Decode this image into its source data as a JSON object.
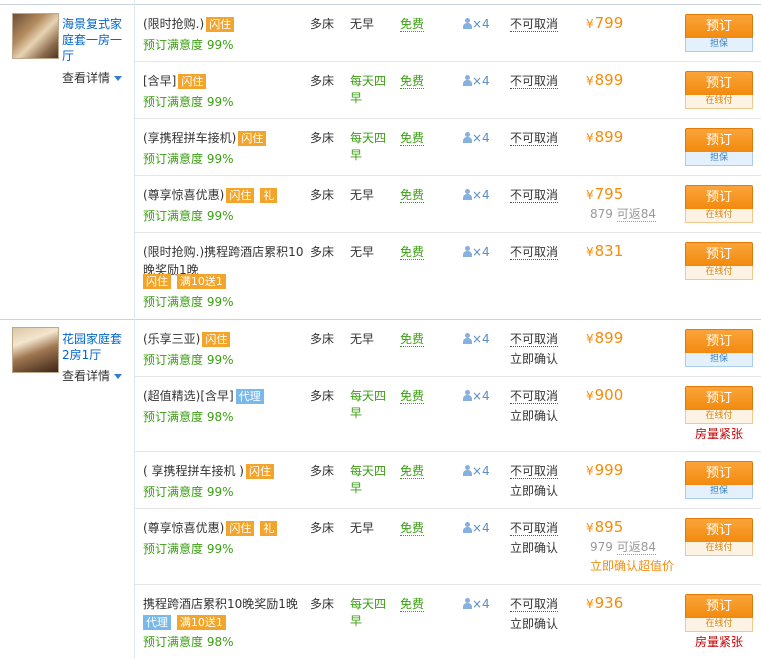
{
  "rooms": [
    {
      "name": "海景复式家庭套一房一厅",
      "detail_label": "查看详情",
      "plans": [
        {
          "title": "(限时抢购.)",
          "tags": [
            {
              "text": "闪住",
              "color": "orange"
            }
          ],
          "satisfaction": "预订满意度 99%",
          "bed": "多床",
          "breakfast": "无早",
          "wifi": "免费",
          "guests": "×4",
          "cancel": "不可取消",
          "instant": "",
          "price": "799",
          "cashback": "",
          "cashback_value": "",
          "book_label": "预订",
          "book_sub": "担保",
          "book_sub_type": "guar",
          "tight": ""
        },
        {
          "title": "[含早]",
          "tags": [
            {
              "text": "闪住",
              "color": "orange"
            }
          ],
          "satisfaction": "预订满意度 99%",
          "bed": "多床",
          "breakfast": "每天四早",
          "wifi": "免费",
          "guests": "×4",
          "cancel": "不可取消",
          "instant": "",
          "price": "899",
          "cashback": "",
          "cashback_value": "",
          "book_label": "预订",
          "book_sub": "在线付",
          "book_sub_type": "payat",
          "tight": ""
        },
        {
          "title": "(享携程拼车接机)",
          "tags": [
            {
              "text": "闪住",
              "color": "orange"
            }
          ],
          "satisfaction": "预订满意度 99%",
          "bed": "多床",
          "breakfast": "每天四早",
          "wifi": "免费",
          "guests": "×4",
          "cancel": "不可取消",
          "instant": "",
          "price": "899",
          "cashback": "",
          "cashback_value": "",
          "book_label": "预订",
          "book_sub": "担保",
          "book_sub_type": "guar",
          "tight": ""
        },
        {
          "title": "(尊享惊喜优惠)",
          "tags": [
            {
              "text": "闪住",
              "color": "orange"
            },
            {
              "text": "礼",
              "color": "orange"
            }
          ],
          "satisfaction": "预订满意度 99%",
          "bed": "多床",
          "breakfast": "无早",
          "wifi": "免费",
          "guests": "×4",
          "cancel": "不可取消",
          "instant": "",
          "price": "795",
          "cashback": "879",
          "cashback_value": "可返84",
          "book_label": "预订",
          "book_sub": "在线付",
          "book_sub_type": "payat",
          "tight": ""
        },
        {
          "title": "(限时抢购.)携程跨酒店累积10晚奖励1晚",
          "tags": [
            {
              "text": "闪住",
              "color": "orange"
            },
            {
              "text": "满10送1",
              "color": "orange"
            }
          ],
          "satisfaction": "预订满意度 99%",
          "bed": "多床",
          "breakfast": "无早",
          "wifi": "免费",
          "guests": "×4",
          "cancel": "不可取消",
          "instant": "",
          "price": "831",
          "cashback": "",
          "cashback_value": "",
          "book_label": "预订",
          "book_sub": "在线付",
          "book_sub_type": "payat",
          "tight": ""
        }
      ]
    },
    {
      "name": "花园家庭套2房1厅",
      "detail_label": "查看详情",
      "plans": [
        {
          "title": "(乐享三亚)",
          "tags": [
            {
              "text": "闪住",
              "color": "orange"
            }
          ],
          "satisfaction": "预订满意度 99%",
          "bed": "多床",
          "breakfast": "无早",
          "wifi": "免费",
          "guests": "×4",
          "cancel": "不可取消",
          "instant": "立即确认",
          "price": "899",
          "cashback": "",
          "cashback_value": "",
          "book_label": "预订",
          "book_sub": "担保",
          "book_sub_type": "guar",
          "tight": ""
        },
        {
          "title": "(超值精选)[含早]",
          "tags": [
            {
              "text": "代理",
              "color": "blue"
            }
          ],
          "satisfaction": "预订满意度 98%",
          "bed": "多床",
          "breakfast": "每天四早",
          "wifi": "免费",
          "guests": "×4",
          "cancel": "不可取消",
          "instant": "立即确认",
          "price": "900",
          "cashback": "",
          "cashback_value": "",
          "book_label": "预订",
          "book_sub": "在线付",
          "book_sub_type": "payat",
          "tight": "房量紧张"
        },
        {
          "title": "( 享携程拼车接机 )",
          "tags": [
            {
              "text": "闪住",
              "color": "orange"
            }
          ],
          "satisfaction": "预订满意度 99%",
          "bed": "多床",
          "breakfast": "每天四早",
          "wifi": "免费",
          "guests": "×4",
          "cancel": "不可取消",
          "instant": "立即确认",
          "price": "999",
          "cashback": "",
          "cashback_value": "",
          "book_label": "预订",
          "book_sub": "担保",
          "book_sub_type": "guar",
          "tight": ""
        },
        {
          "title": "(尊享惊喜优惠)",
          "tags": [
            {
              "text": "闪住",
              "color": "orange"
            },
            {
              "text": "礼",
              "color": "orange"
            }
          ],
          "satisfaction": "预订满意度 99%",
          "bed": "多床",
          "breakfast": "无早",
          "wifi": "免费",
          "guests": "×4",
          "cancel": "不可取消",
          "instant": "立即确认",
          "price": "895",
          "cashback": "979",
          "cashback_value": "可返84",
          "confirm_value": "立即确认超值价",
          "book_label": "预订",
          "book_sub": "在线付",
          "book_sub_type": "payat",
          "tight": ""
        },
        {
          "title": "携程跨酒店累积10晚奖励1晚",
          "tags": [
            {
              "text": "代理",
              "color": "blue"
            },
            {
              "text": "满10送1",
              "color": "orange"
            }
          ],
          "satisfaction": "预订满意度 98%",
          "bed": "多床",
          "breakfast": "每天四早",
          "wifi": "免费",
          "guests": "×4",
          "cancel": "不可取消",
          "instant": "立即确认",
          "price": "936",
          "cashback": "",
          "cashback_value": "",
          "book_label": "预订",
          "book_sub": "在线付",
          "book_sub_type": "payat",
          "tight": "房量紧张"
        }
      ]
    }
  ],
  "currency_symbol": "¥",
  "colors": {
    "price": "#f58c0a",
    "satisfaction": "#3a9e12",
    "link": "#0066cc",
    "book_button": "#f28a0e",
    "tight": "#c40000"
  },
  "icons": {
    "guest": "person-icon",
    "expand": "triangle-down-icon"
  }
}
